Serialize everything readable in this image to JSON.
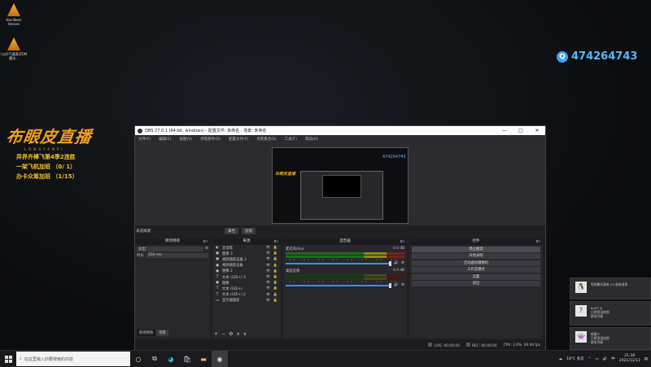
{
  "desktop": {
    "icons": [
      {
        "label": "Has-Been Heroes"
      },
      {
        "label": "(以约气满满)ZOM魔法..."
      }
    ],
    "brand": {
      "logo": "布眼皮直播",
      "sub": "LONGYANPI",
      "lines": [
        "异界齐棒飞第4季2连胜",
        "一架飞机加班  （0/ 1）",
        "办卡众筹加班  （1/15）"
      ]
    },
    "qq_number": "474264743"
  },
  "obs": {
    "title": "OBS 27.0.1 (64-bit, windows) - 配置文件: 未命名 - 场景: 未命名",
    "window_controls": [
      "—",
      "□",
      "✕"
    ],
    "menu": [
      "文件(F)",
      "编辑(E)",
      "视图(V)",
      "停靠部件(D)",
      "配置文件(P)",
      "场景集合(S)",
      "工具(T)",
      "帮助(H)"
    ],
    "scene_label": "未选择源",
    "scene_buttons": [
      "属性",
      "滤镜"
    ],
    "docks": {
      "scenes_title": "转场特效",
      "sources_title": "来源",
      "mixer_title": "混音器",
      "controls_title": "控件"
    },
    "transition": {
      "type_value": "淡出",
      "duration_key": "时长",
      "duration_value": "250 ms"
    },
    "sources": [
      {
        "icon": "◐",
        "name": "音试库"
      },
      {
        "icon": "▣",
        "name": "图像 3"
      },
      {
        "icon": "▣",
        "name": "视频捕获设备 2"
      },
      {
        "icon": "▣",
        "name": "视频捕获设备"
      },
      {
        "icon": "▣",
        "name": "图像 2"
      },
      {
        "icon": "T",
        "name": "文本 (GDI+) 3"
      },
      {
        "icon": "▣",
        "name": "图像"
      },
      {
        "icon": "T",
        "name": "文本 (GDI+)"
      },
      {
        "icon": "T",
        "name": "文本 (GDI+) 2"
      },
      {
        "icon": "▭",
        "name": "显示器捕获"
      }
    ],
    "source_ctl": "👁 🔒",
    "dock_foot": [
      "+",
      "−",
      "⚙",
      "∧",
      "∨"
    ],
    "mixer": [
      {
        "name": "麦克风/Aux",
        "db": "0.0 dB",
        "active": true
      },
      {
        "name": "桌面音频",
        "db": "0.0 dB",
        "active": false
      }
    ],
    "meter_ticks": "-60 -55 -50 -45 -40 -35 -30 -25 -20 -15 -10 -5 0",
    "controls": [
      "停止推流",
      "开始录制",
      "启动虚拟摄像机",
      "工作室模式",
      "设置",
      "退出"
    ],
    "bottom_tabs": [
      "转场特效",
      "场景"
    ],
    "status": {
      "live": "LIVE: 00:00:00",
      "rec": "REC: 00:00:00",
      "cpu": "CPU: 2.0%, 60.00 fps"
    }
  },
  "notifications": [
    {
      "icon": "🐧",
      "title": "您的聊天窗有 23 条新消息",
      "body": ""
    },
    {
      "icon": "?",
      "title": "bu97 N",
      "body": "已将您添加到\n群发列表"
    },
    {
      "icon": "👾",
      "title": "新建人",
      "body": "已将您添加到\n群发列表"
    }
  ],
  "taskbar": {
    "search_placeholder": "在这里输入你要搜索的内容",
    "weather": "18°C 多云",
    "ime": "中",
    "time": "21:38",
    "date": "2021/11/13"
  }
}
